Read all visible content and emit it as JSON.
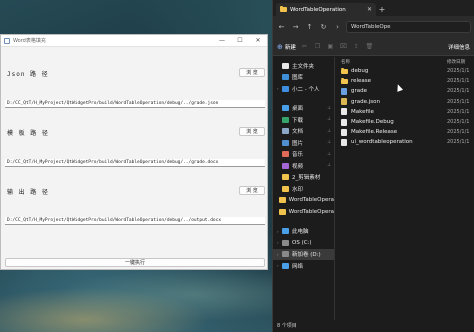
{
  "qt_window": {
    "title": "Word表格填充",
    "controls": {
      "minimize": "—",
      "maximize": "☐",
      "close": "✕"
    },
    "json_label": "Json 路 径",
    "json_button": "浏 览",
    "json_path": "D:/CC_QtT/H_MyProject/QtWidgetPro/build/WordTableOperation/debug/../grade.json",
    "template_label": "模 板 路 径",
    "template_button": "浏 览",
    "template_path": "D:/CC_QtT/H_MyProject/QtWidgetPro/build/WordTableOperation/debug/../grade.docx",
    "output_label": "输 出 路 径",
    "output_button": "浏 览",
    "output_path": "D:/CC_QtT/H_MyProject/QtWidgetPro/build/WordTableOperation/debug/../output.docx",
    "execute_button": "一键执行"
  },
  "explorer": {
    "tab_title": "WordTableOperation",
    "tab_close": "✕",
    "tab_add": "+",
    "nav": {
      "back": "←",
      "forward": "→",
      "up": "↑",
      "refresh": "↻",
      "more": "›"
    },
    "breadcrumb": "WordTableOpe",
    "toolbar": {
      "new_label": "新建",
      "details_label": "详细信息"
    },
    "sidebar": [
      {
        "label": "主文件夹",
        "icon": "home-icon",
        "color": "#e8e8e8",
        "caret": ""
      },
      {
        "label": "图库",
        "icon": "gallery-icon",
        "color": "#3f8fd8",
        "caret": ""
      },
      {
        "label": "小二 - 个人",
        "icon": "cloud-icon",
        "color": "#3d8ee0",
        "caret": "›"
      },
      {
        "label": "桌面",
        "icon": "desktop-icon",
        "color": "#4aa0e8",
        "pin": "📌"
      },
      {
        "label": "下载",
        "icon": "download-icon",
        "color": "#36a56b",
        "pin": "📌"
      },
      {
        "label": "文档",
        "icon": "documents-icon",
        "color": "#8aa7c8",
        "pin": "📌"
      },
      {
        "label": "图片",
        "icon": "pictures-icon",
        "color": "#4f8fd0",
        "pin": "📌"
      },
      {
        "label": "音乐",
        "icon": "music-icon",
        "color": "#e06a58",
        "pin": "📌"
      },
      {
        "label": "视频",
        "icon": "videos-icon",
        "color": "#a468d6",
        "pin": "📌"
      },
      {
        "label": "2_剪辑素材",
        "icon": "folder-icon",
        "color": "#f1c24c"
      },
      {
        "label": "水印",
        "icon": "folder-icon",
        "color": "#f1c24c"
      },
      {
        "label": "WordTableOpera",
        "icon": "folder-icon",
        "color": "#f1c24c"
      },
      {
        "label": "WordTableOpera",
        "icon": "folder-icon",
        "color": "#f1c24c"
      },
      {
        "label": "此电脑",
        "icon": "computer-icon",
        "color": "#4aa0e8",
        "caret": "›"
      },
      {
        "label": "OS (C:)",
        "icon": "drive-icon",
        "color": "#8a8a8a",
        "caret": "›"
      },
      {
        "label": "新加卷 (D:)",
        "icon": "drive-icon",
        "color": "#8a8a8a",
        "caret": "›"
      },
      {
        "label": "网络",
        "icon": "network-icon",
        "color": "#4aa0e8",
        "caret": "›"
      }
    ],
    "columns": {
      "name": "名称",
      "date": "修改日期"
    },
    "files": [
      {
        "name": "debug",
        "type": "folder",
        "date": "2025/1/1"
      },
      {
        "name": "release",
        "type": "folder",
        "date": "2025/1/1"
      },
      {
        "name": "grade",
        "type": "app",
        "date": "2025/1/1"
      },
      {
        "name": "grade.json",
        "type": "json",
        "date": "2025/1/1"
      },
      {
        "name": "Makefile",
        "type": "file",
        "date": "2025/1/1"
      },
      {
        "name": "Makefile.Debug",
        "type": "file",
        "date": "2025/1/1"
      },
      {
        "name": "Makefile.Release",
        "type": "file",
        "date": "2025/1/1"
      },
      {
        "name": "ui_wordtableoperation",
        "type": "file",
        "date": "2025/1/1"
      }
    ],
    "status": "8 个项目"
  }
}
